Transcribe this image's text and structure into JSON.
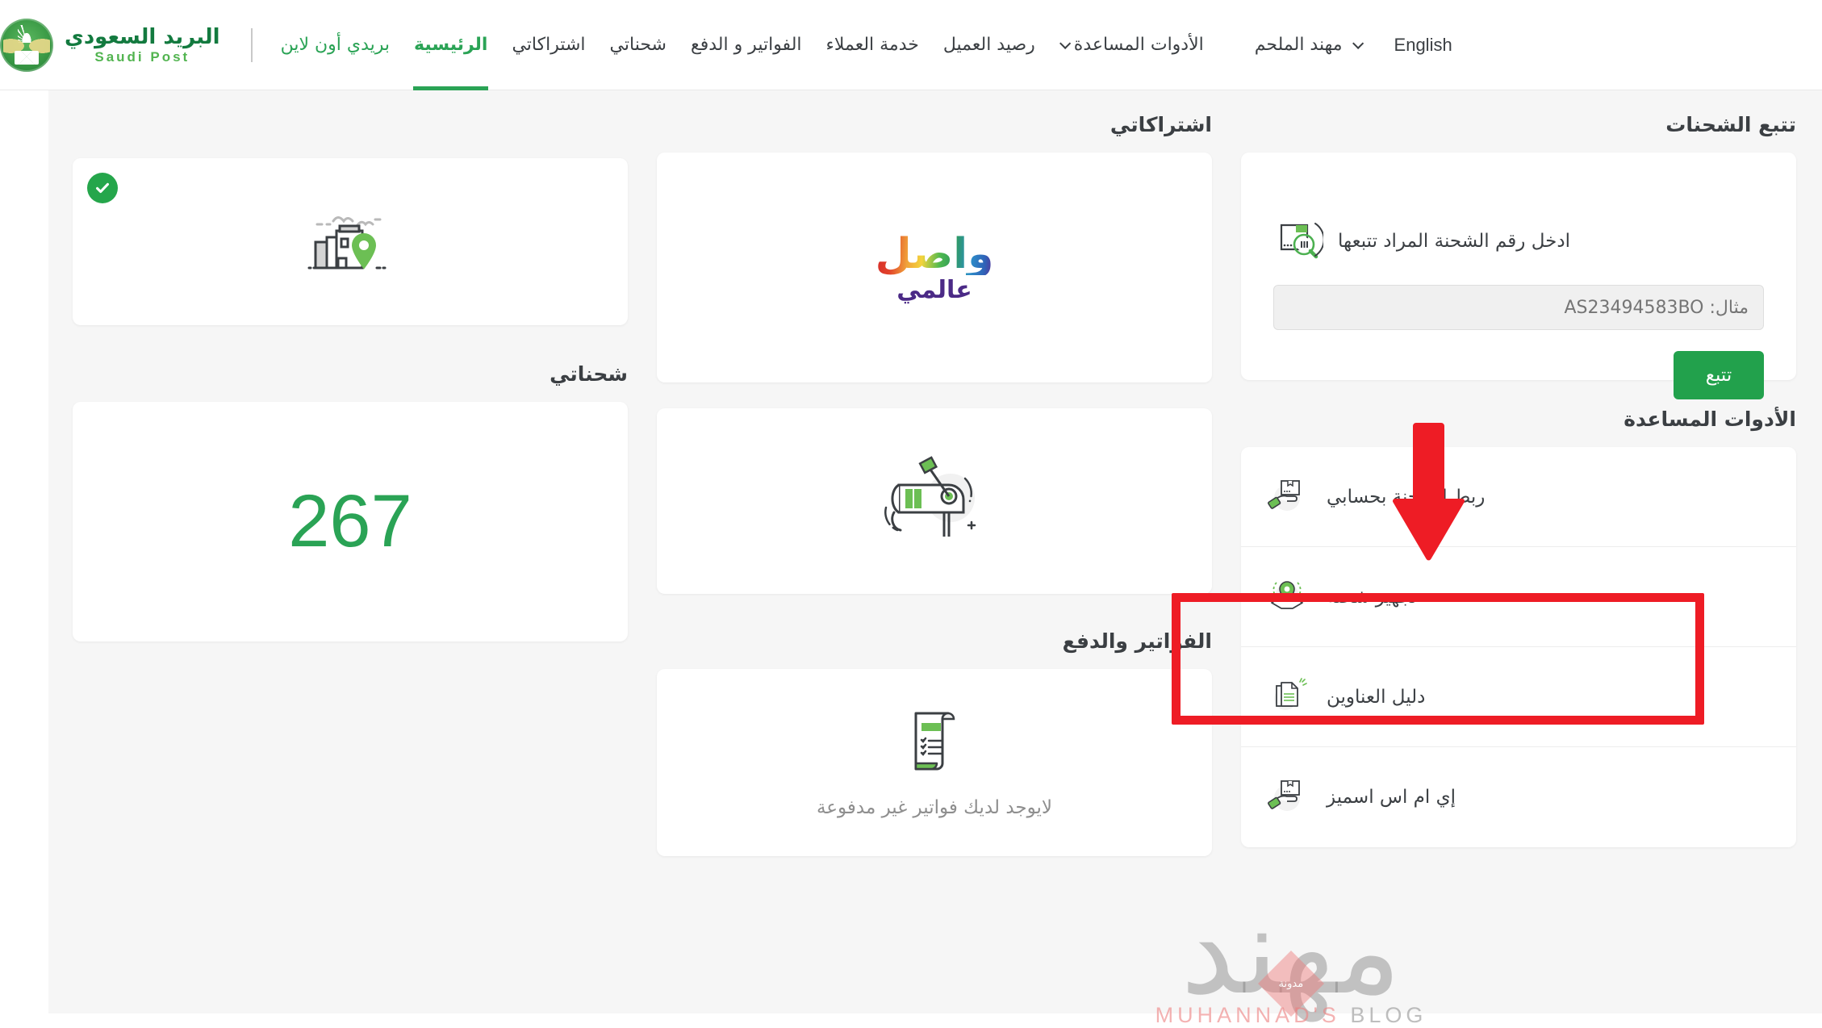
{
  "header": {
    "brand": {
      "arabic": "البريد السعودي",
      "english": "Saudi Post",
      "emblem_icon": "saudi-post-emblem"
    },
    "nav": [
      {
        "label": "بريدي أون لاين",
        "state": "green"
      },
      {
        "label": "الرئيسية",
        "state": "active"
      },
      {
        "label": "اشتراكاتي",
        "state": "normal"
      },
      {
        "label": "شحناتي",
        "state": "normal"
      },
      {
        "label": "الفواتير و الدفع",
        "state": "normal"
      },
      {
        "label": "خدمة العملاء",
        "state": "normal"
      },
      {
        "label": "رصيد العميل",
        "state": "normal"
      },
      {
        "label": "الأدوات المساعدة",
        "state": "dropdown"
      }
    ],
    "user_name": "مهند الملحم",
    "language_toggle": "English"
  },
  "tracking": {
    "section_title": "تتبع الشحنات",
    "prompt": "ادخل رقم الشحنة المراد تتبعها",
    "input_placeholder": "مثال: AS23494583BO",
    "input_value": "",
    "button_label": "تتبع",
    "icon": "package-search-icon"
  },
  "tools": {
    "section_title": "الأدوات المساعدة",
    "items": [
      {
        "label": "ربط الشحنة بحسابي",
        "icon": "hand-package-icon",
        "highlighted": true
      },
      {
        "label": "تجهيز شحنة",
        "icon": "map-pin-icon",
        "highlighted": false
      },
      {
        "label": "دليل العناوين",
        "icon": "documents-icon",
        "highlighted": false
      },
      {
        "label": "إي ام اس اسميز",
        "icon": "hand-package-icon",
        "highlighted": false
      }
    ]
  },
  "subscriptions": {
    "section_title": "اشتراكاتي",
    "wasel_logo_main": "واصل",
    "wasel_logo_sub": "عالمي",
    "mailbox_icon": "mailbox-icon"
  },
  "invoices": {
    "section_title": "الفواتير والدفع",
    "empty_message": "لايوجد لديك فواتير غير مدفوعة",
    "icon": "invoice-receipt-icon"
  },
  "address": {
    "icon": "building-location-icon",
    "verified_badge": "check-circle-icon"
  },
  "shipments": {
    "section_title": "شحناتي",
    "count": "267"
  },
  "watermark": {
    "arabic": "مهند",
    "diamond_label": "مدونة",
    "english_first": "MUHANNAD'S",
    "english_second": "BLOG"
  },
  "annotations": {
    "arrow_color": "#ee1c25",
    "highlight_color": "#ee1c25"
  },
  "colors": {
    "brand_green": "#137a3f",
    "accent_green": "#2aa355",
    "button_green": "#22a14c",
    "page_bg": "#f6f6f6"
  }
}
